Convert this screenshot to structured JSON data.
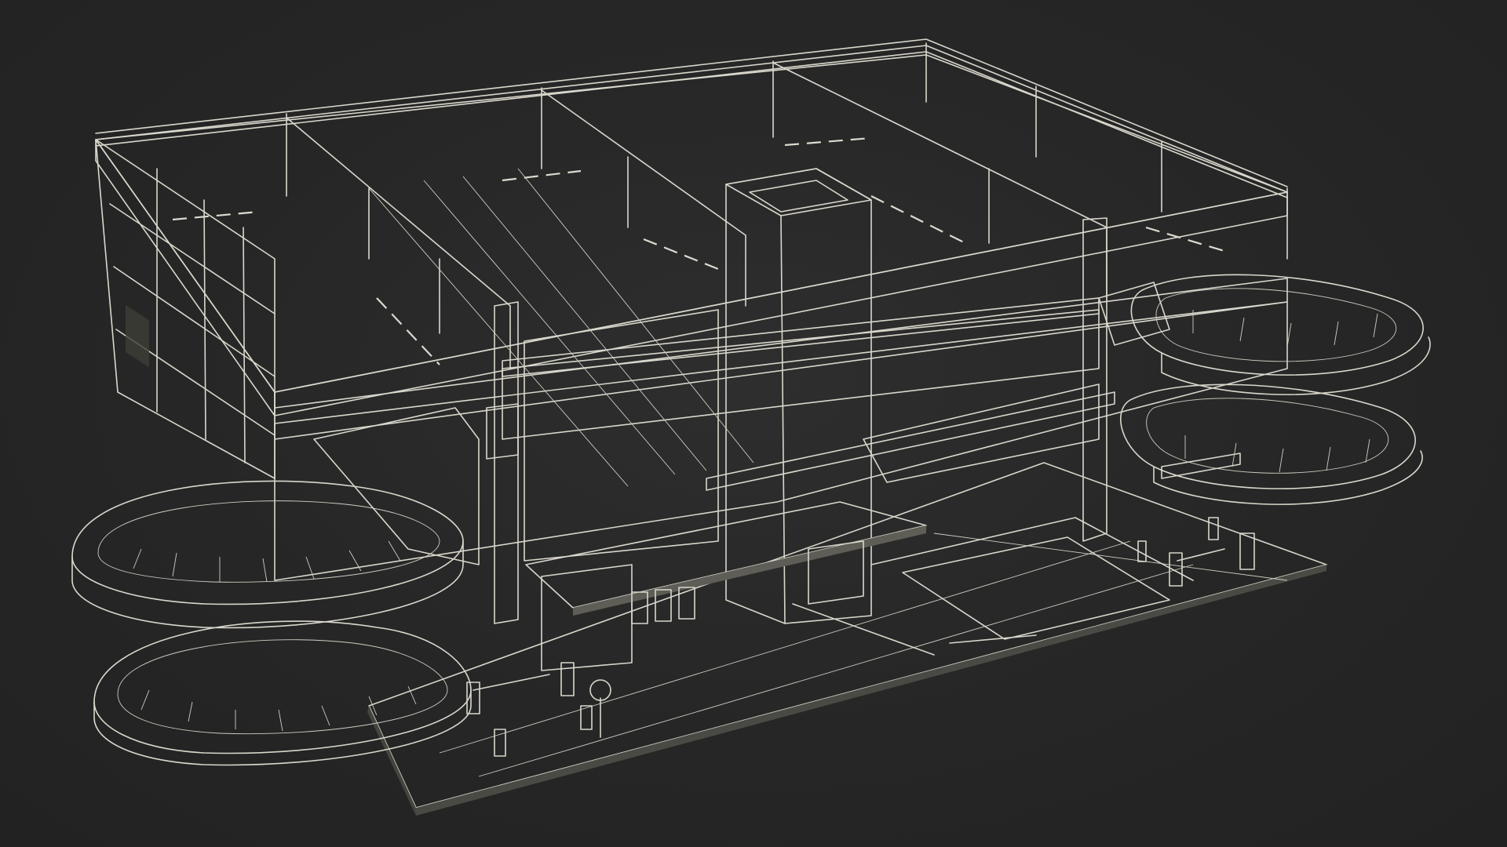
{
  "scene": {
    "subject": "parking-garage-3d-model",
    "render_style": "wireframe-over-shaded",
    "colors": {
      "background": "#262626",
      "surface_light": "#8d8d82",
      "surface_mid": "#6f6f66",
      "surface_dark": "#4f4f48",
      "shadow": "#3a3a35",
      "wireframe": "#d9d7cc",
      "glow": "#c9c9c0"
    }
  }
}
